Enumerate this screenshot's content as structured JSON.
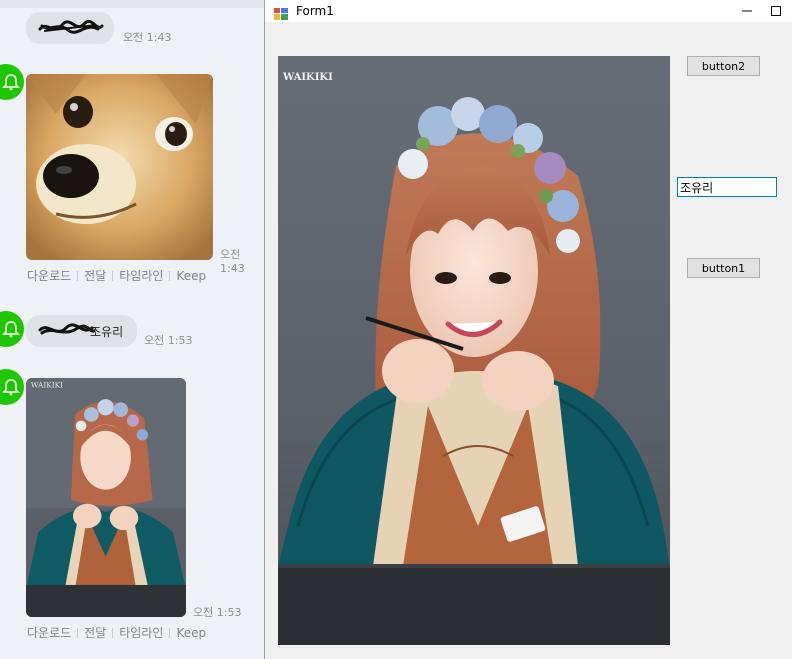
{
  "chat": {
    "messages": [
      {
        "text": "",
        "time": "오전 1:43"
      },
      {
        "time": "오전 1:43",
        "actions": [
          "다운로드",
          "전달",
          "타임라인",
          "Keep"
        ]
      },
      {
        "text": "조유리",
        "time": "오전 1:53"
      },
      {
        "time": "오전 1:53",
        "actions": [
          "다운로드",
          "전달",
          "타임라인",
          "Keep"
        ],
        "photo_watermark": "WAIKIKI"
      }
    ],
    "colors": {
      "avatar": "#1ec800",
      "bubble": "#dfe3e8",
      "background": "#eef1f5"
    }
  },
  "window": {
    "title": "Form1",
    "controls": {
      "minimize": "—",
      "maximize": "☐"
    },
    "picture_watermark": "WAIKIKI",
    "button2": "button2",
    "button1": "button1",
    "textbox_value": "조유리"
  }
}
